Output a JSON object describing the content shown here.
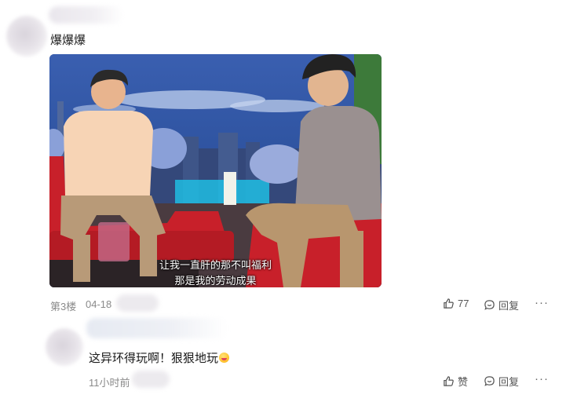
{
  "comment1": {
    "text": "爆爆爆",
    "floor": "第3楼",
    "date": "04-18",
    "likes": "77",
    "reply_label": "回复",
    "more_label": "···",
    "video": {
      "subtitle_line1": "让我一直肝的那不叫福利",
      "subtitle_line2": "那是我的劳动成果"
    }
  },
  "comment2": {
    "text": "这异环得玩啊！狠狠地玩",
    "time": "11小时前",
    "like_label": "赞",
    "reply_label": "回复",
    "more_label": "···"
  },
  "colors": {
    "sofa_red": "#c8202a",
    "sky_blue": "#2a4f9a",
    "meta_gray": "#8a8a8a"
  }
}
